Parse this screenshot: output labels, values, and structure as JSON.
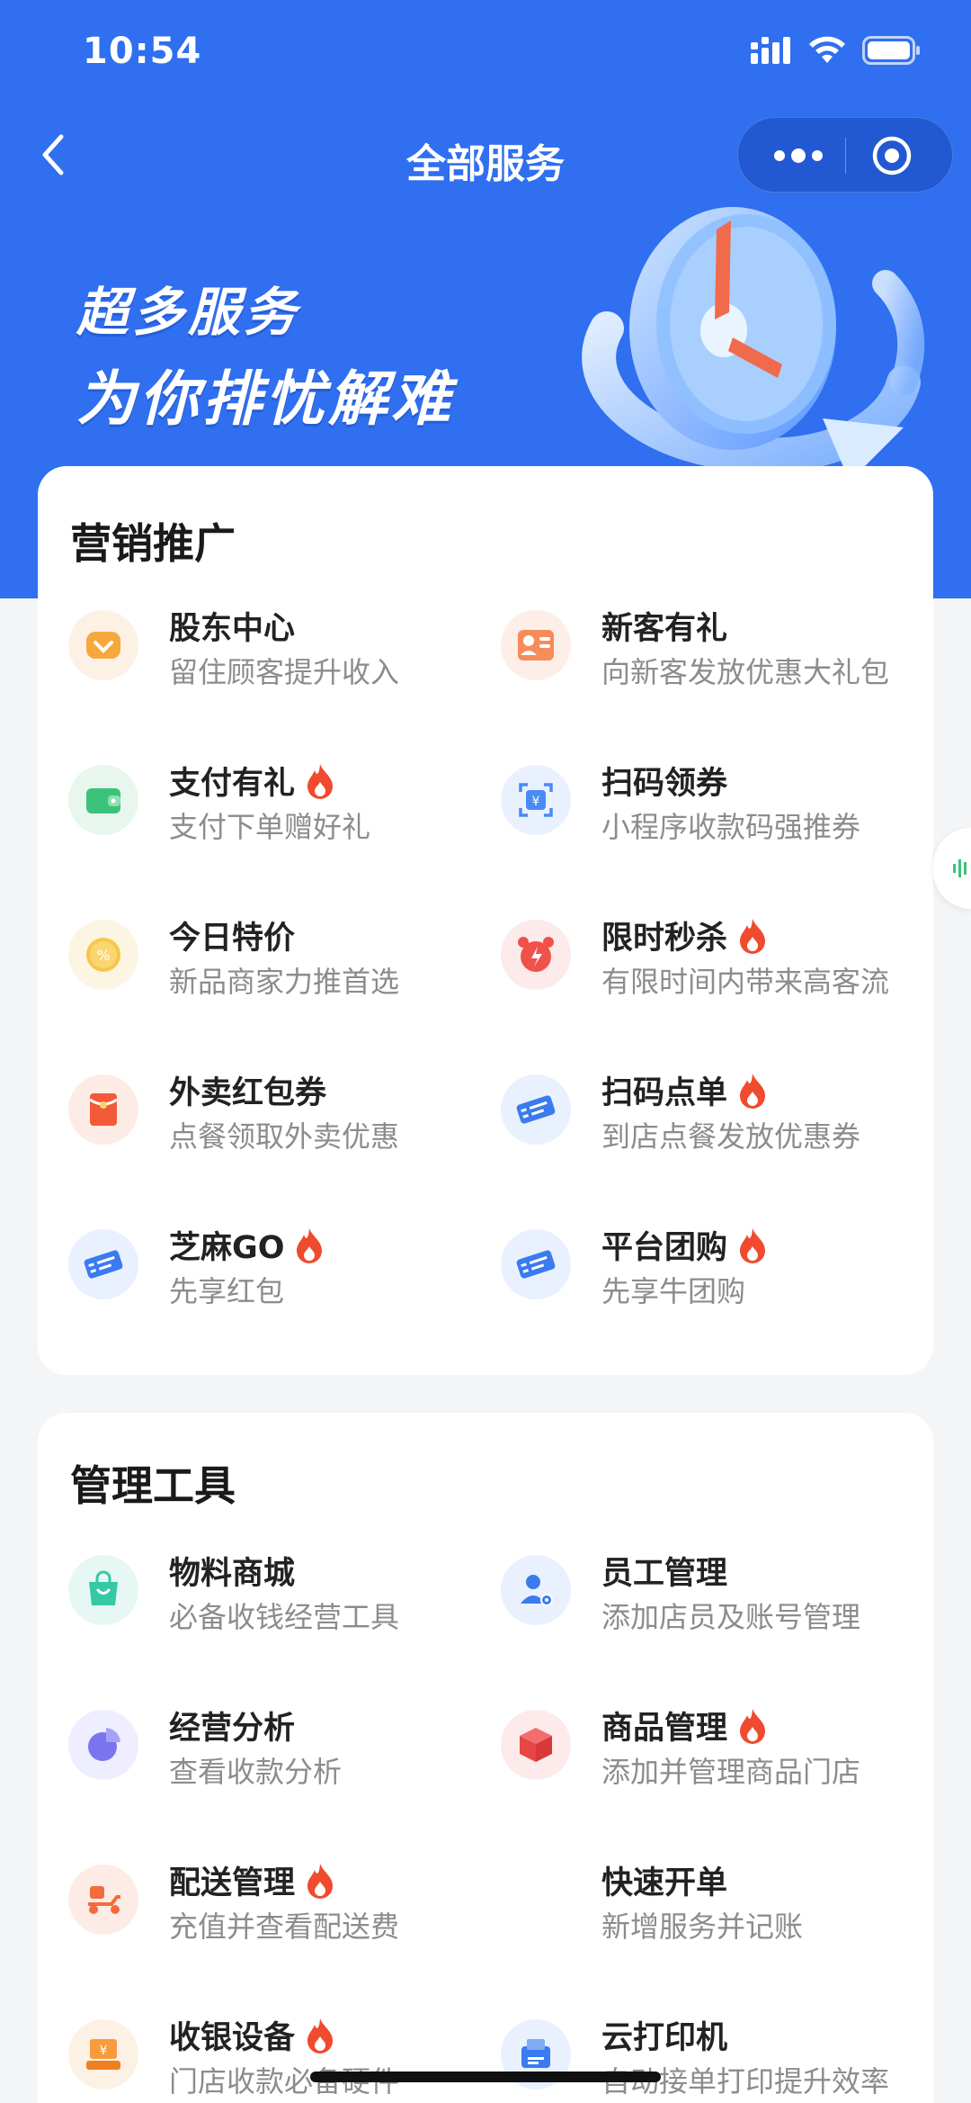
{
  "status": {
    "time": "10:54"
  },
  "nav": {
    "title": "全部服务"
  },
  "hero": {
    "line1": "超多服务",
    "line2": "为你排忧解难"
  },
  "sections": [
    {
      "title": "营销推广",
      "items": [
        {
          "name": "股东中心",
          "desc": "留住顾客提升收入",
          "hot": false,
          "icon": "diamond-icon"
        },
        {
          "name": "新客有礼",
          "desc": "向新客发放优惠大礼包",
          "hot": false,
          "icon": "id-card-icon"
        },
        {
          "name": "支付有礼",
          "desc": "支付下单赠好礼",
          "hot": true,
          "icon": "wallet-icon"
        },
        {
          "name": "扫码领券",
          "desc": "小程序收款码强推券",
          "hot": false,
          "icon": "scan-coupon-icon"
        },
        {
          "name": "今日特价",
          "desc": "新品商家力推首选",
          "hot": false,
          "icon": "discount-badge-icon"
        },
        {
          "name": "限时秒杀",
          "desc": "有限时间内带来高客流",
          "hot": true,
          "icon": "alarm-clock-icon"
        },
        {
          "name": "外卖红包券",
          "desc": "点餐领取外卖优惠",
          "hot": false,
          "icon": "red-envelope-icon"
        },
        {
          "name": "扫码点单",
          "desc": "到店点餐发放优惠券",
          "hot": true,
          "icon": "ticket-icon"
        },
        {
          "name": "芝麻GO",
          "desc": "先享红包",
          "hot": true,
          "icon": "ticket-icon"
        },
        {
          "name": "平台团购",
          "desc": "先享牛团购",
          "hot": true,
          "icon": "ticket-icon"
        }
      ]
    },
    {
      "title": "管理工具",
      "items": [
        {
          "name": "物料商城",
          "desc": "必备收钱经营工具",
          "hot": false,
          "icon": "shopping-bag-icon"
        },
        {
          "name": "员工管理",
          "desc": "添加店员及账号管理",
          "hot": false,
          "icon": "user-settings-icon"
        },
        {
          "name": "经营分析",
          "desc": "查看收款分析",
          "hot": false,
          "icon": "pie-chart-icon"
        },
        {
          "name": "商品管理",
          "desc": "添加并管理商品门店",
          "hot": true,
          "icon": "box-icon"
        },
        {
          "name": "配送管理",
          "desc": "充值并查看配送费",
          "hot": true,
          "icon": "scooter-icon"
        },
        {
          "name": "快速开单",
          "desc": "新增服务并记账",
          "hot": false,
          "icon": "none"
        },
        {
          "name": "收银设备",
          "desc": "门店收款必备硬件",
          "hot": true,
          "icon": "cashier-icon"
        },
        {
          "name": "云打印机",
          "desc": "自动接单打印提升效率",
          "hot": false,
          "icon": "printer-icon"
        }
      ]
    }
  ],
  "colors": {
    "primary": "#2f6ff0",
    "hot": "#f04a2f"
  }
}
